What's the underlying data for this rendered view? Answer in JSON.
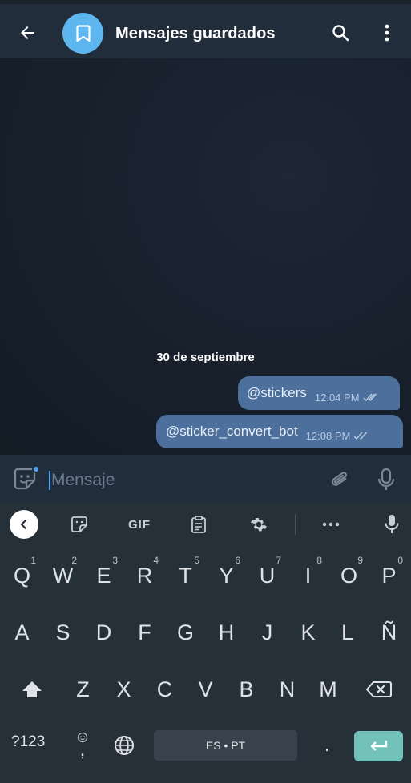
{
  "header": {
    "title": "Mensajes guardados",
    "back_icon": "arrow-left-icon",
    "avatar_icon": "bookmark-icon",
    "search_icon": "search-icon",
    "menu_icon": "more-vertical-icon",
    "avatar_color": "#5db7ee"
  },
  "chat": {
    "date_separator": "30 de septiembre",
    "messages": [
      {
        "text": "@stickers",
        "time": "12:04 PM",
        "status": "read"
      },
      {
        "text": "@sticker_convert_bot",
        "time": "12:08 PM",
        "status": "read"
      }
    ],
    "bubble_color": "#4c6f9b"
  },
  "composer": {
    "placeholder": "Mensaje",
    "value": "",
    "sticker_icon": "sticker-icon",
    "attach_icon": "paperclip-icon",
    "mic_icon": "microphone-icon",
    "accent": "#4ea4f6"
  },
  "keyboard": {
    "toolbar": {
      "collapse_icon": "chevron-left-icon",
      "sticker_icon": "sticker-icon",
      "gif_label": "GIF",
      "clipboard_icon": "clipboard-icon",
      "settings_icon": "gear-icon",
      "more_icon": "more-horizontal-icon",
      "voice_icon": "microphone-icon"
    },
    "row1": [
      {
        "key": "Q",
        "hint": "1"
      },
      {
        "key": "W",
        "hint": "2"
      },
      {
        "key": "E",
        "hint": "3"
      },
      {
        "key": "R",
        "hint": "4"
      },
      {
        "key": "T",
        "hint": "5"
      },
      {
        "key": "Y",
        "hint": "6"
      },
      {
        "key": "U",
        "hint": "7"
      },
      {
        "key": "I",
        "hint": "8"
      },
      {
        "key": "O",
        "hint": "9"
      },
      {
        "key": "P",
        "hint": "0"
      }
    ],
    "row2": [
      "A",
      "S",
      "D",
      "F",
      "G",
      "H",
      "J",
      "K",
      "L",
      "Ñ"
    ],
    "row3": [
      "Z",
      "X",
      "C",
      "V",
      "B",
      "N",
      "M"
    ],
    "shift_icon": "shift-icon",
    "backspace_icon": "backspace-icon",
    "symbols_label": "?123",
    "comma_label": ",",
    "emoji_hint_icon": "emoji-icon",
    "globe_icon": "globe-icon",
    "space_label": "ES • PT",
    "period_label": ".",
    "enter_icon": "enter-icon",
    "enter_color": "#72c2ba"
  }
}
